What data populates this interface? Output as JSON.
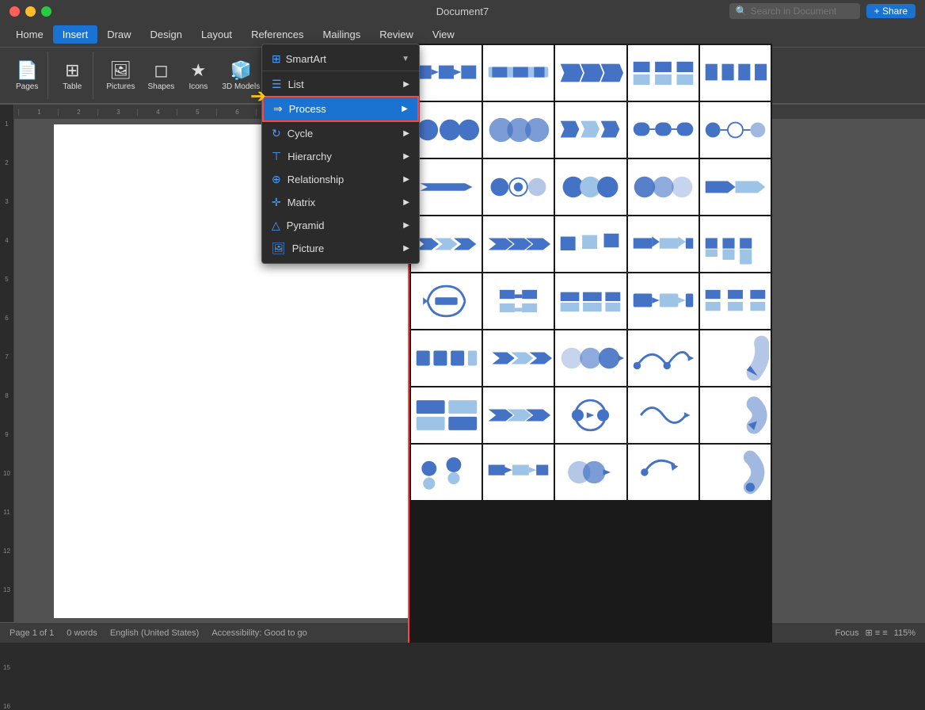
{
  "titleBar": {
    "title": "Document7",
    "searchPlaceholder": "Search in Document",
    "shareLabel": "+ Share"
  },
  "ribbonNav": {
    "items": [
      "Home",
      "Insert",
      "Draw",
      "Design",
      "Layout",
      "References",
      "Mailings",
      "Review",
      "View"
    ]
  },
  "activeTab": "Insert",
  "ribbonGroups": [
    {
      "name": "pages",
      "items": [
        {
          "label": "Pages",
          "icon": "📄"
        }
      ]
    },
    {
      "name": "tables",
      "items": [
        {
          "label": "Table",
          "icon": "⊞"
        }
      ]
    },
    {
      "name": "illustrations",
      "items": [
        {
          "label": "Pictures",
          "icon": "🖼"
        },
        {
          "label": "Shapes",
          "icon": "◻"
        },
        {
          "label": "Icons",
          "icon": "★"
        },
        {
          "label": "3D Models",
          "icon": "🧊"
        }
      ]
    }
  ],
  "smartArtMenu": {
    "headerLabel": "SmartArt",
    "items": [
      {
        "id": "list",
        "label": "List",
        "icon": "☰",
        "hasSubmenu": true
      },
      {
        "id": "process",
        "label": "Process",
        "icon": "⇒",
        "hasSubmenu": true,
        "active": true
      },
      {
        "id": "cycle",
        "label": "Cycle",
        "icon": "↻",
        "hasSubmenu": true
      },
      {
        "id": "hierarchy",
        "label": "Hierarchy",
        "icon": "⊤",
        "hasSubmenu": true
      },
      {
        "id": "relationship",
        "label": "Relationship",
        "icon": "⊕",
        "hasSubmenu": true
      },
      {
        "id": "matrix",
        "label": "Matrix",
        "icon": "+",
        "hasSubmenu": true
      },
      {
        "id": "pyramid",
        "label": "Pyramid",
        "icon": "△",
        "hasSubmenu": true
      },
      {
        "id": "picture",
        "label": "Picture",
        "icon": "🖼",
        "hasSubmenu": true
      }
    ]
  },
  "statusBar": {
    "page": "Page 1 of 1",
    "words": "0 words",
    "language": "English (United States)",
    "accessibility": "Accessibility: Good to go",
    "focus": "Focus",
    "zoom": "115%"
  },
  "colors": {
    "accent": "#1a72d1",
    "activeMenu": "#1a72d1",
    "menuBorder": "#ff4444",
    "diagramBlue": "#4472c4",
    "diagramLightBlue": "#9dc3e6",
    "diagramDark": "#2e5599"
  }
}
